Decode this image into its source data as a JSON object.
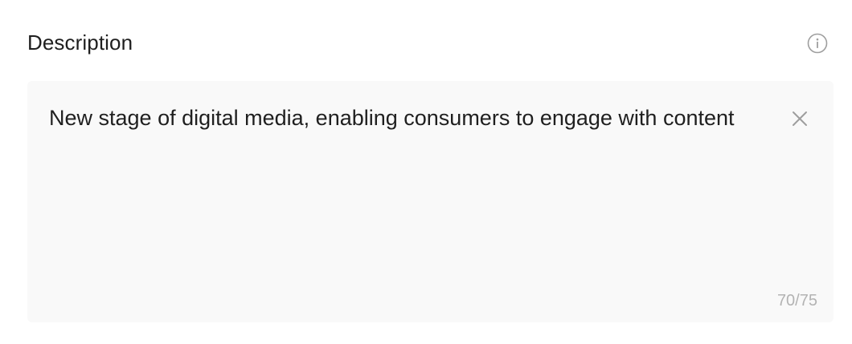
{
  "field": {
    "label": "Description",
    "info_icon": "info-circle-icon",
    "value": "New stage of digital media, enabling consumers to engage with content",
    "clear_icon": "close-icon",
    "counter": "70/75"
  },
  "colors": {
    "label": "#1f1f1f",
    "text": "#1f1f1f",
    "field_background": "#f9f9f9",
    "icon": "#9e9e9e",
    "counter": "#b3b3b3"
  }
}
